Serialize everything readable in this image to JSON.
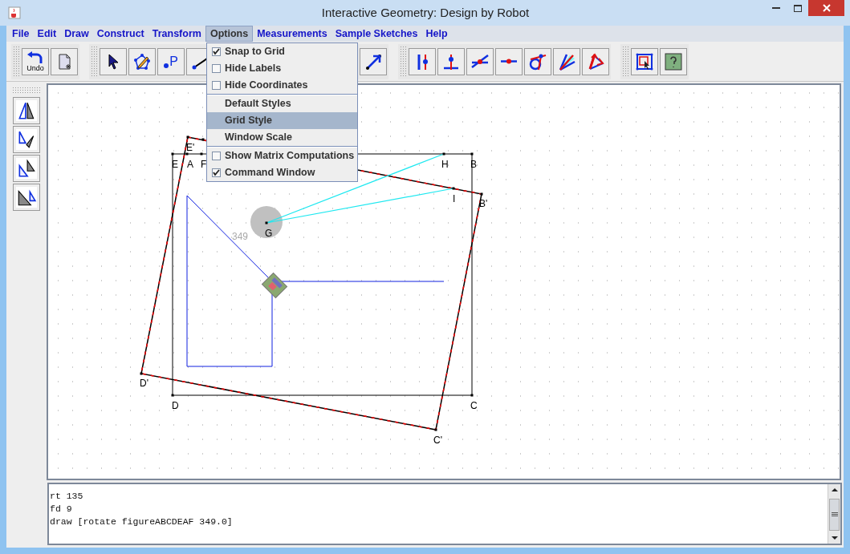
{
  "window": {
    "title": "Interactive Geometry: Design by Robot"
  },
  "menu": [
    {
      "label": "File",
      "selected": false
    },
    {
      "label": "Edit",
      "selected": false
    },
    {
      "label": "Draw",
      "selected": false
    },
    {
      "label": "Construct",
      "selected": false
    },
    {
      "label": "Transform",
      "selected": false
    },
    {
      "label": "Options",
      "selected": true
    },
    {
      "label": "Measurements",
      "selected": false
    },
    {
      "label": "Sample Sketches",
      "selected": false
    },
    {
      "label": "Help",
      "selected": false
    }
  ],
  "options_menu": {
    "groups": [
      [
        {
          "kind": "check",
          "label": "Snap to Grid",
          "checked": true,
          "selected": false
        },
        {
          "kind": "check",
          "label": "Hide Labels",
          "checked": false,
          "selected": false
        },
        {
          "kind": "check",
          "label": "Hide Coordinates",
          "checked": false,
          "selected": false
        }
      ],
      [
        {
          "kind": "plain",
          "label": "Default Styles",
          "selected": false
        },
        {
          "kind": "plain",
          "label": "Grid Style",
          "selected": true
        },
        {
          "kind": "plain",
          "label": "Window Scale",
          "selected": false
        }
      ],
      [
        {
          "kind": "check",
          "label": "Show Matrix Computations",
          "checked": false,
          "selected": false
        },
        {
          "kind": "check",
          "label": "Command Window",
          "checked": true,
          "selected": false
        }
      ]
    ]
  },
  "toolbar": {
    "undo_label": "Undo",
    "point_label": "P"
  },
  "canvas": {
    "labels": [
      "E'",
      "E",
      "A",
      "F",
      "H",
      "B",
      "I",
      "B'",
      "G",
      "D'",
      "D",
      "C",
      "C'"
    ],
    "angle_reading": "349"
  },
  "command_window": {
    "lines": [
      "rt 135",
      "fd 9",
      "draw [rotate figureABCDEAF 349.0]"
    ]
  }
}
